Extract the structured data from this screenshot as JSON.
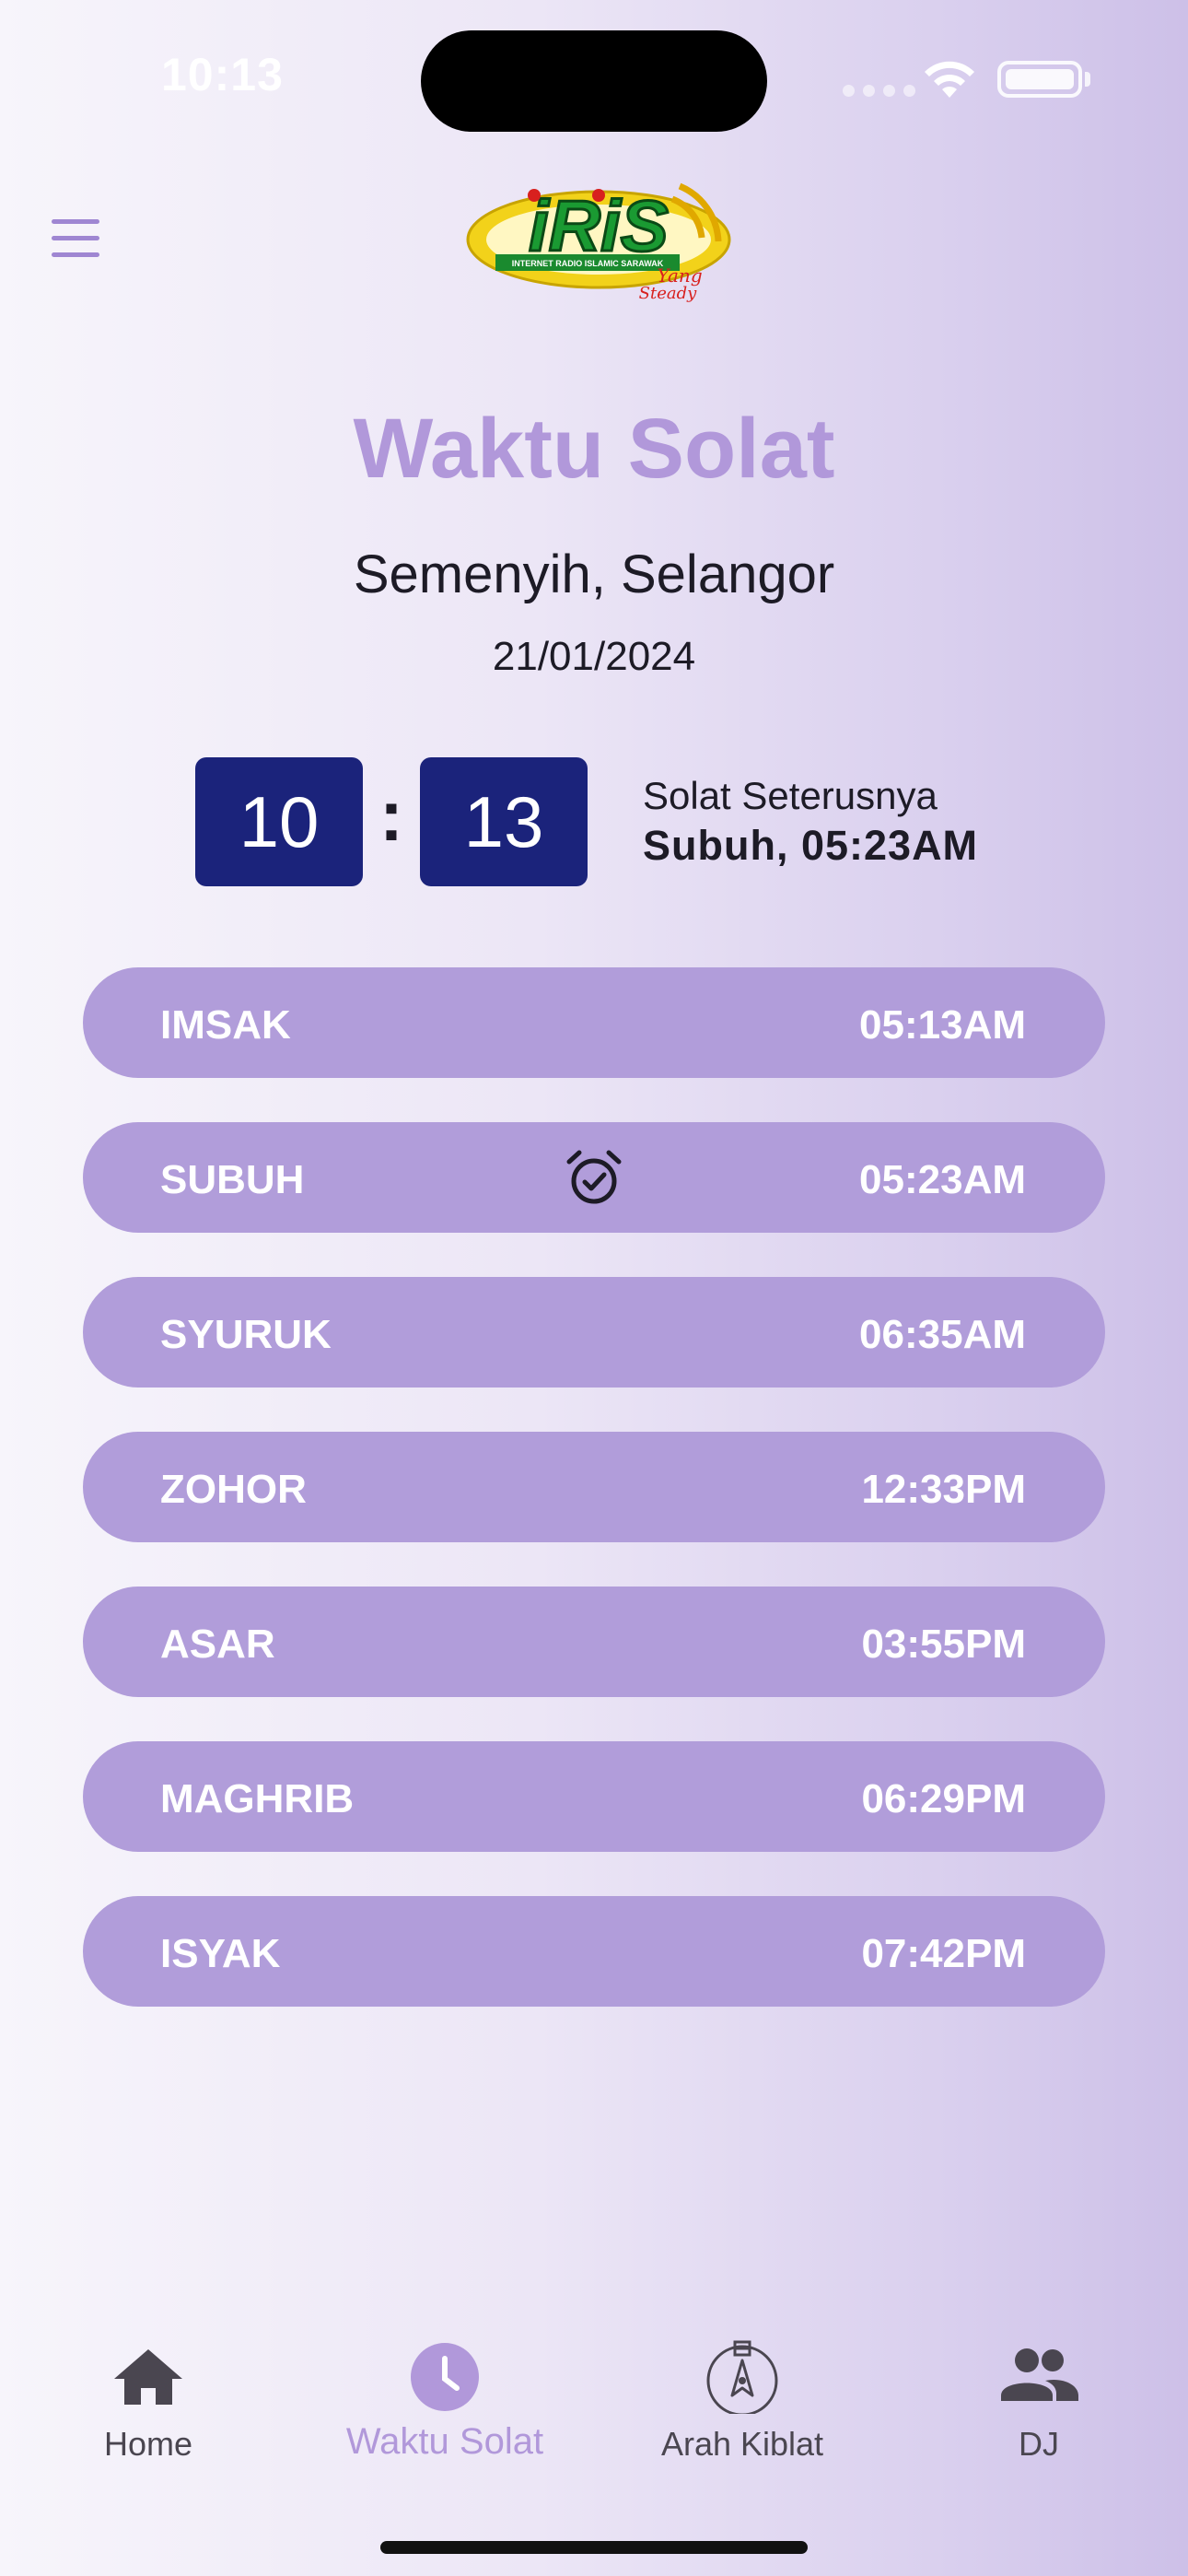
{
  "status_bar": {
    "time": "10:13"
  },
  "header": {
    "menu_icon": "hamburger-menu-icon",
    "logo": {
      "main": "iRiS",
      "tagline": "INTERNET RADIO ISLAMIC SARAWAK",
      "script": "Yang Steady"
    }
  },
  "page": {
    "title": "Waktu Solat",
    "location": "Semenyih, Selangor",
    "date": "21/01/2024"
  },
  "clock": {
    "hours": "10",
    "separator": ":",
    "minutes": "13",
    "next_label": "Solat Seterusnya",
    "next_value": "Subuh, 05:23AM"
  },
  "prayers": [
    {
      "name": "IMSAK",
      "time": "05:13AM"
    },
    {
      "name": "SUBUH",
      "time": "05:23AM",
      "alarm_icon": "alarm-check-icon"
    },
    {
      "name": "SYURUK",
      "time": "06:35AM"
    },
    {
      "name": "ZOHOR",
      "time": "12:33PM"
    },
    {
      "name": "ASAR",
      "time": "03:55PM"
    },
    {
      "name": "MAGHRIB",
      "time": "06:29PM"
    },
    {
      "name": "ISYAK",
      "time": "07:42PM"
    }
  ],
  "nav": {
    "items": [
      {
        "label": "Home",
        "icon": "home-icon"
      },
      {
        "label": "Waktu Solat",
        "icon": "clock-icon",
        "active": true
      },
      {
        "label": "Arah Kiblat",
        "icon": "compass-icon"
      },
      {
        "label": "DJ",
        "icon": "people-icon"
      }
    ]
  },
  "colors": {
    "accent": "#b198da",
    "row_bg": "#b19dda",
    "clock_bg": "#1b237b",
    "text_dark": "#1d1b26"
  }
}
